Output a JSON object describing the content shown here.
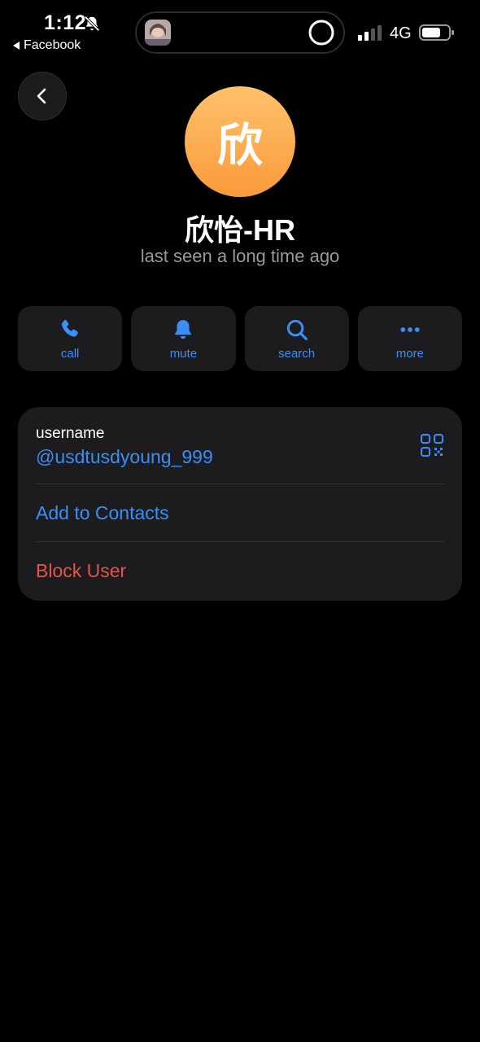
{
  "status_bar": {
    "time": "1:12",
    "back_app_label": "Facebook",
    "network": "4G"
  },
  "profile": {
    "avatar_initial": "欣",
    "name": "欣怡-HR",
    "last_seen": "last seen a long time ago"
  },
  "actions": {
    "call": "call",
    "mute": "mute",
    "search": "search",
    "more": "more"
  },
  "info": {
    "username_label": "username",
    "username_value": "@usdtusdyoung_999",
    "add_contacts": "Add to Contacts",
    "block_user": "Block User"
  },
  "colors": {
    "accent": "#3a8ef6",
    "danger": "#e5534b",
    "avatar_top": "#ffc26b",
    "avatar_bottom": "#f99a3a",
    "card": "#1c1c1e",
    "background": "#000000"
  }
}
